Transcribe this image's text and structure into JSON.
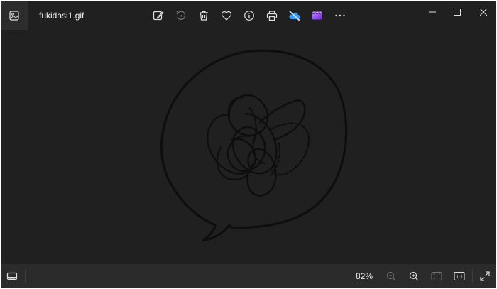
{
  "window": {
    "filename": "fukidasi1.gif"
  },
  "toolbar": {
    "buttons": [
      "edit-image",
      "rotate",
      "delete",
      "favorite",
      "file-info",
      "print",
      "onedrive-sync",
      "video-editor",
      "see-more"
    ]
  },
  "colors": {
    "background": "#202020",
    "bottombar": "#2b2b2b",
    "icon": "#e0e0e0",
    "onedrive_blue": "#3a9bf0",
    "clipchamp_purple": "#8b5cf6"
  },
  "bottombar": {
    "zoom_level": "82%",
    "fit_label": "1:1"
  }
}
